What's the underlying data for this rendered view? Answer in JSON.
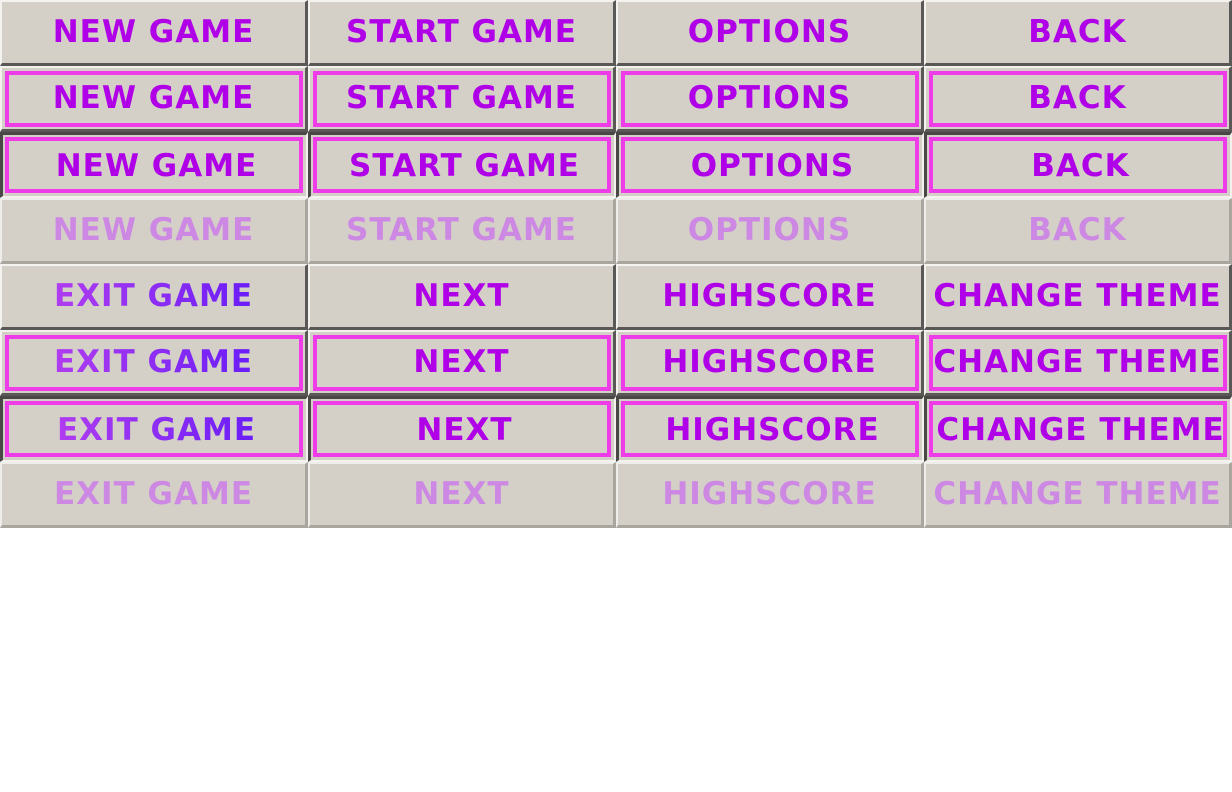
{
  "sheet": {
    "set_a": {
      "new_game": "NEW GAME",
      "start_game": "START GAME",
      "options": "OPTIONS",
      "back": "BACK"
    },
    "set_b": {
      "exit_game": "EXIT GAME",
      "next": "NEXT",
      "highscore": "HIGHSCORE",
      "change_theme": "CHANGE THEME"
    }
  },
  "colors": {
    "button_face": "#d4d0c8",
    "label": "#b000e8",
    "focus_frame": "#ee3ce8",
    "disabled_label": "#cd88e4",
    "bevel_light": "#f4f2ee",
    "bevel_dark": "#5a5856"
  }
}
